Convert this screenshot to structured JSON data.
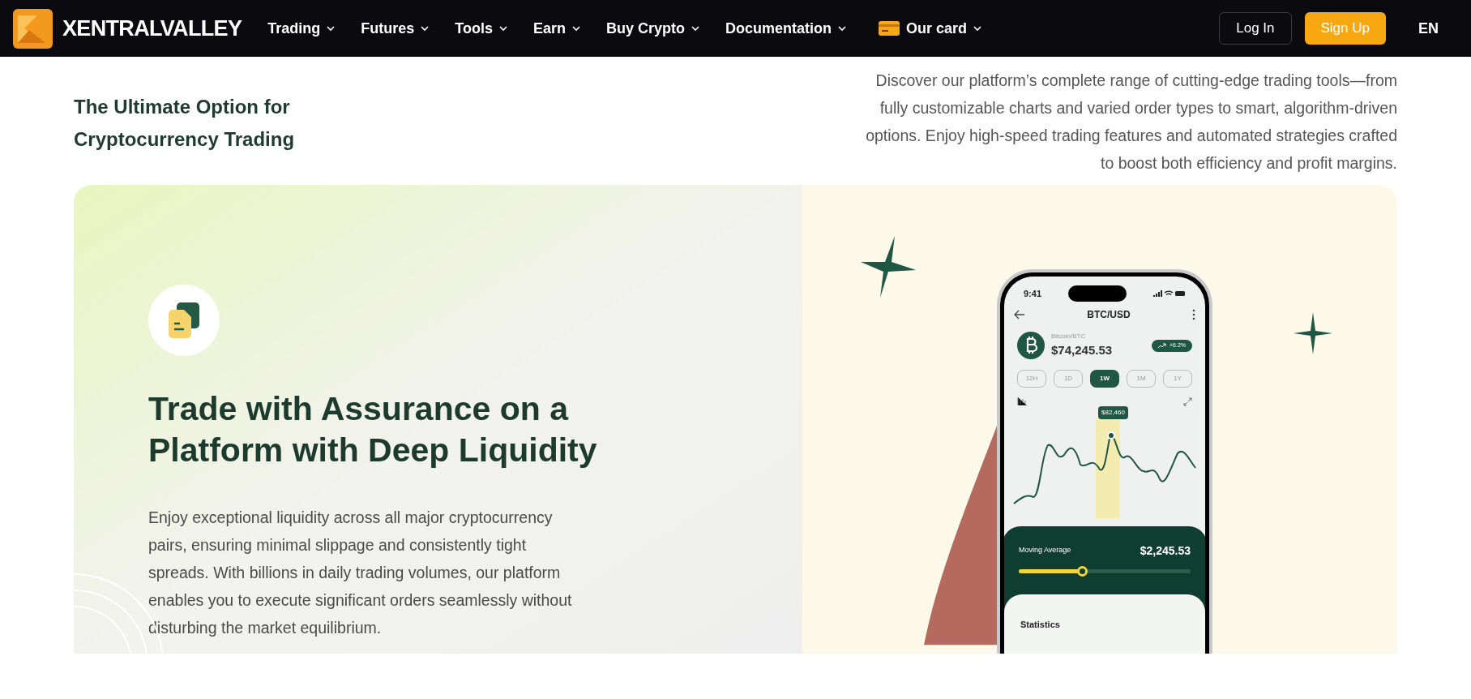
{
  "nav": {
    "logo": "XENTRALVALLEY",
    "items": [
      {
        "label": "Trading",
        "kind": "menu"
      },
      {
        "label": "Futures",
        "kind": "menu"
      },
      {
        "label": "Tools",
        "kind": "menu"
      },
      {
        "label": "Earn",
        "kind": "menu"
      },
      {
        "label": "Buy Crypto",
        "kind": "menu"
      },
      {
        "label": "Documentation",
        "kind": "menu"
      },
      {
        "label": "Our card",
        "kind": "card"
      }
    ],
    "login": "Log In",
    "signup": "Sign Up",
    "language": "EN"
  },
  "intro": {
    "heading": "The Ultimate Option for Cryptocurrency Trading",
    "text": "Discover our platform’s complete range of cutting-edge trading tools—from fully customizable charts and varied order types to smart, algorithm-driven options. Enjoy high-speed trading features and automated strategies crafted to boost both efficiency and profit margins."
  },
  "feature": {
    "heading": "Trade with Assurance on a Platform with Deep Liquidity",
    "text": "Enjoy exceptional liquidity across all major cryptocurrency pairs, ensuring minimal slippage and consistently tight spreads. With billions in daily trading volumes, our platform enables you to execute significant orders seamlessly without disturbing the market equilibrium."
  },
  "phone": {
    "time": "9:41",
    "title": "BTC/USD",
    "coin_label": "Bitcoin/BTC",
    "price": "$74,245.53",
    "change": "+6.2%",
    "ranges": [
      {
        "label": "12H",
        "selected": false
      },
      {
        "label": "1D",
        "selected": false
      },
      {
        "label": "1W",
        "selected": true
      },
      {
        "label": "1M",
        "selected": false
      },
      {
        "label": "1Y",
        "selected": false
      }
    ],
    "tooltip": "$82,460",
    "moving_average": {
      "label": "Moving Average",
      "value": "$2,245.53",
      "level": 0.37
    },
    "statistics": "Statistics"
  }
}
